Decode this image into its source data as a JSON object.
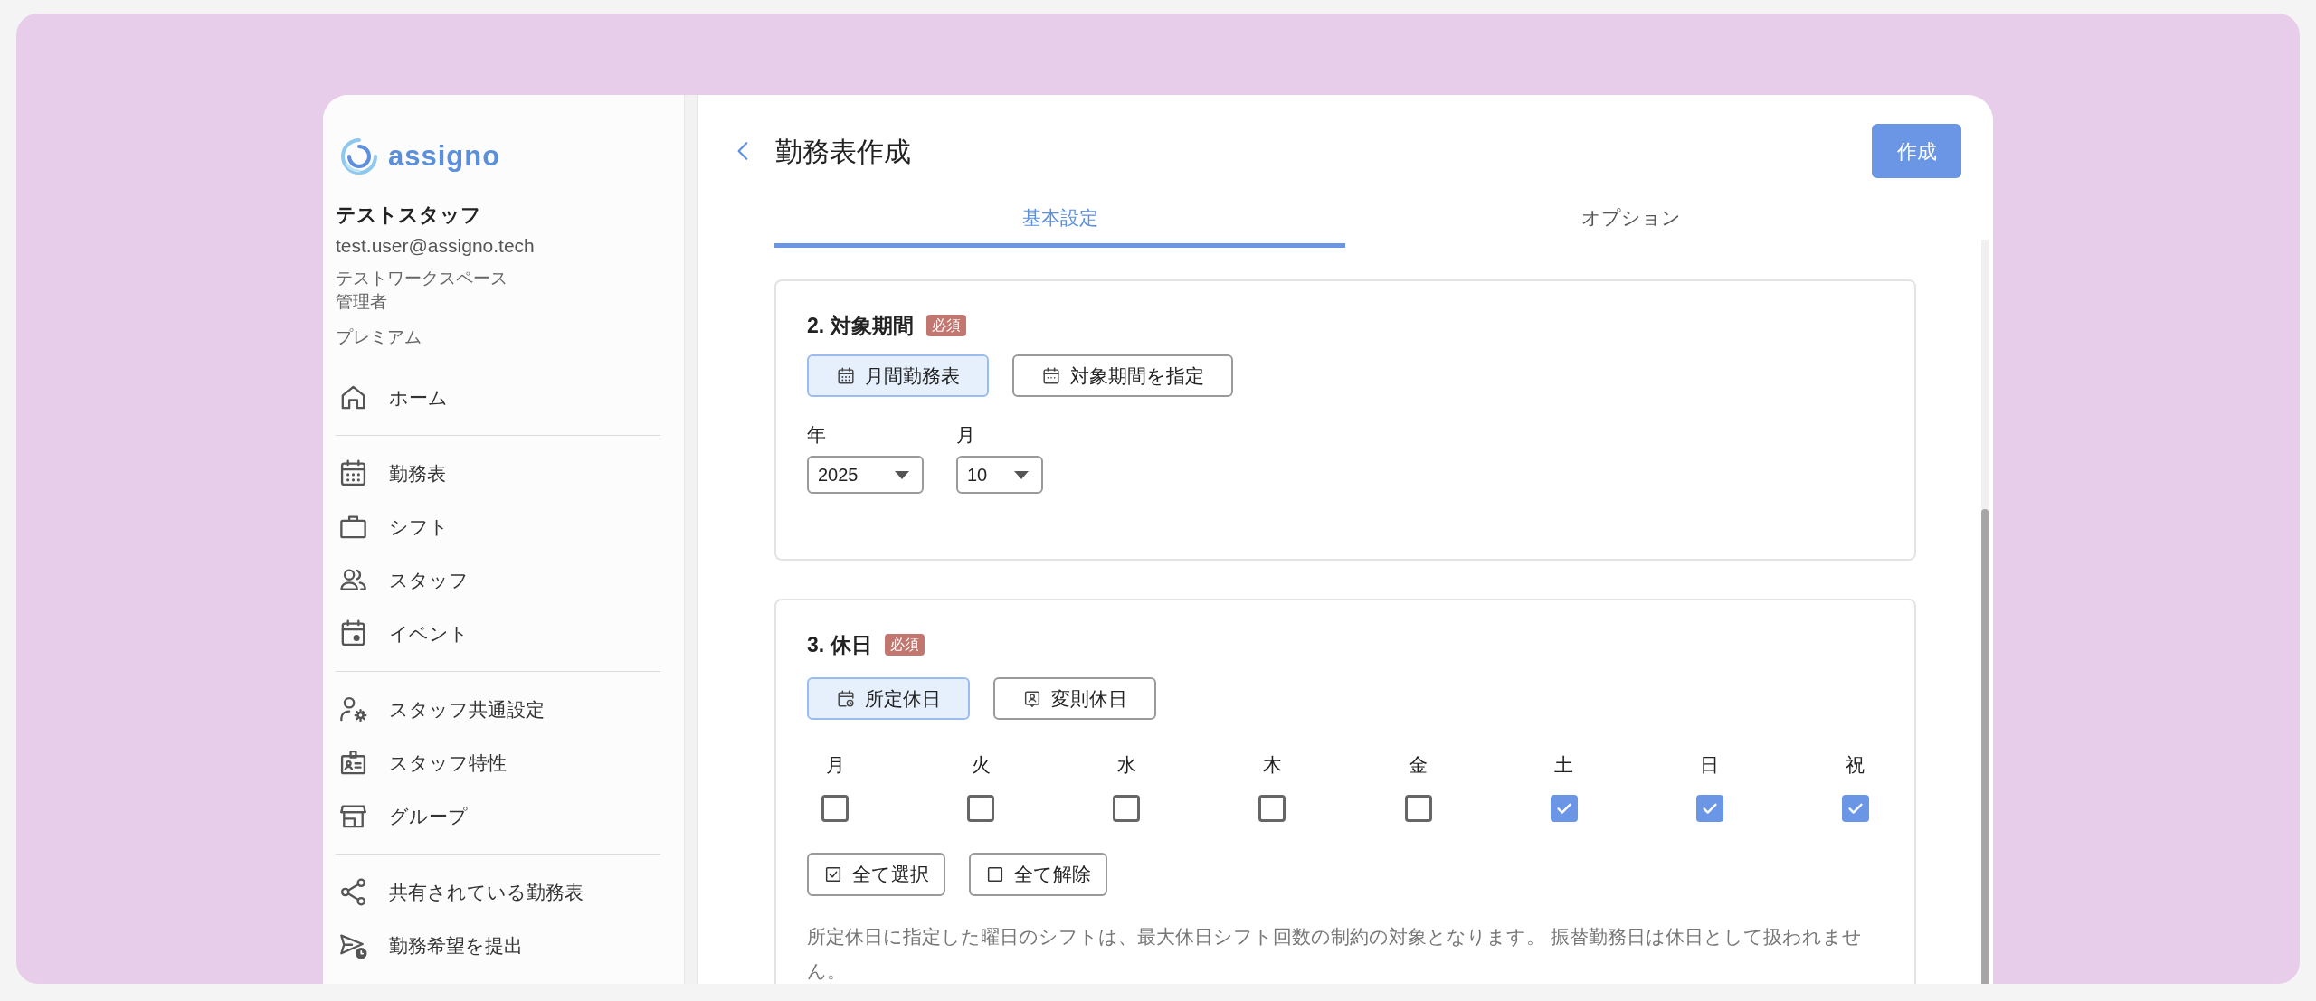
{
  "sidebar": {
    "logo": "assigno",
    "user": {
      "name": "テストスタッフ",
      "email": "test.user@assigno.tech",
      "workspace": "テストワークスペース",
      "role": "管理者",
      "plan": "プレミアム"
    },
    "nav_groups": [
      [
        {
          "label": "ホーム",
          "selected": false
        }
      ],
      [
        {
          "label": "勤務表",
          "selected": false
        },
        {
          "label": "シフト",
          "selected": false
        },
        {
          "label": "スタッフ",
          "selected": false
        },
        {
          "label": "イベント",
          "selected": false
        }
      ],
      [
        {
          "label": "スタッフ共通設定",
          "selected": false
        },
        {
          "label": "スタッフ特性",
          "selected": false
        },
        {
          "label": "グループ",
          "selected": false
        }
      ],
      [
        {
          "label": "共有されている勤務表",
          "selected": false
        },
        {
          "label": "勤務希望を提出",
          "selected": false
        }
      ]
    ]
  },
  "header": {
    "title": "勤務表作成",
    "action": "作成"
  },
  "tabs": [
    {
      "label": "基本設定",
      "selected": true
    },
    {
      "label": "オプション",
      "selected": false
    }
  ],
  "sections": [
    {
      "title": "2. 対象期間",
      "badge": "必須",
      "modes": [
        {
          "label": "月間勤務表",
          "selected": true
        },
        {
          "label": "対象期間を指定",
          "selected": false
        }
      ],
      "selects": [
        {
          "label": "年",
          "value": "2025"
        },
        {
          "label": "月",
          "value": "10"
        }
      ]
    },
    {
      "title": "3. 休日",
      "badge": "必須",
      "modes": [
        {
          "label": "所定休日",
          "selected": true
        },
        {
          "label": "変則休日",
          "selected": false
        }
      ],
      "days": [
        {
          "label": "月",
          "checked": false
        },
        {
          "label": "火",
          "checked": false
        },
        {
          "label": "水",
          "checked": false
        },
        {
          "label": "木",
          "checked": false
        },
        {
          "label": "金",
          "checked": false
        },
        {
          "label": "土",
          "checked": true
        },
        {
          "label": "日",
          "checked": true
        },
        {
          "label": "祝",
          "checked": true
        }
      ],
      "bulk_buttons": [
        "全て選択",
        "全て解除"
      ],
      "note": "所定休日に指定した曜日のシフトは、最大休日シフト回数の制約の対象となります。 振替勤務日は休日として扱われません。"
    }
  ]
}
